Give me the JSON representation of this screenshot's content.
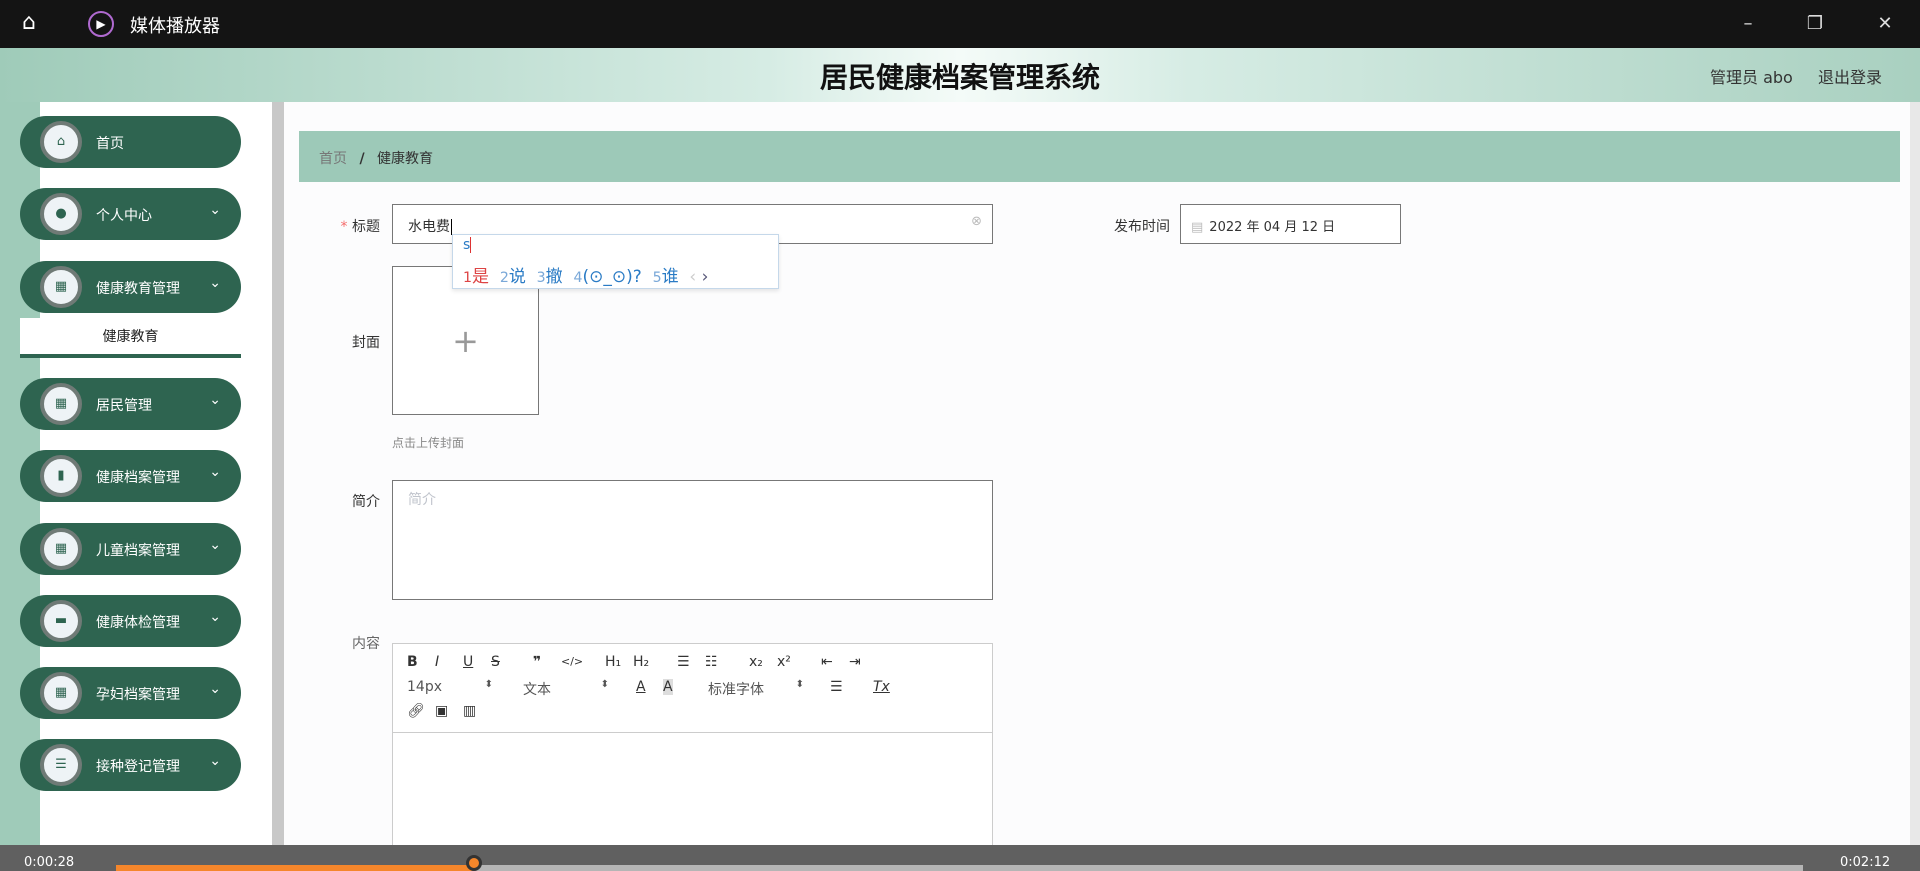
{
  "window": {
    "title": "媒体播放器",
    "icons": [
      "home-icon",
      "play-icon",
      "minimize-icon",
      "restore-icon",
      "close-icon"
    ]
  },
  "header": {
    "system_title": "居民健康档案管理系统",
    "user": "管理员 abo",
    "logout": "退出登录"
  },
  "sidebar": {
    "items": [
      {
        "label": "首页",
        "icon": "home-icon"
      },
      {
        "label": "个人中心",
        "icon": "person-icon"
      },
      {
        "label": "健康教育管理",
        "icon": "grid-icon"
      },
      {
        "label": "居民管理",
        "icon": "grid-icon"
      },
      {
        "label": "健康档案管理",
        "icon": "bar-chart-icon"
      },
      {
        "label": "儿童档案管理",
        "icon": "grid-icon"
      },
      {
        "label": "健康体检管理",
        "icon": "chat-icon"
      },
      {
        "label": "孕妇档案管理",
        "icon": "grid-icon"
      },
      {
        "label": "接种登记管理",
        "icon": "list-icon"
      }
    ],
    "submenu": "健康教育"
  },
  "breadcrumb": {
    "home": "首页",
    "sep": "/",
    "current": "健康教育"
  },
  "form": {
    "title_label": "标题",
    "required_mark": "*",
    "title_value": "水电费",
    "publish_label": "发布时间",
    "publish_value": "2022 年 04 月 12 日",
    "cover_label": "封面",
    "cover_hint": "点击上传封面",
    "intro_label": "简介",
    "intro_placeholder": "简介",
    "content_label": "内容"
  },
  "ime": {
    "input": "s",
    "candidates": [
      {
        "n": "1",
        "t": "是"
      },
      {
        "n": "2",
        "t": "说"
      },
      {
        "n": "3",
        "t": "撤"
      },
      {
        "n": "4",
        "t": "(⊙_⊙)?"
      },
      {
        "n": "5",
        "t": "谁"
      }
    ],
    "prev": "‹",
    "next": "›"
  },
  "editor": {
    "row1": [
      "B",
      "I",
      "U",
      "S",
      "❞",
      "</>",
      "H₁",
      "H₂",
      "☰",
      "☷",
      "x₂",
      "x²",
      "⇤",
      "⇥"
    ],
    "font_size": "14px",
    "block": "文本",
    "font_family": "标准字体",
    "clean": "Tx"
  },
  "player": {
    "elapsed": "0:00:28",
    "total": "0:02:12",
    "progress": 0.212
  }
}
